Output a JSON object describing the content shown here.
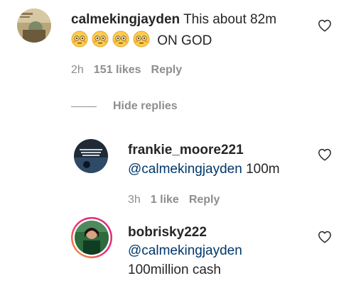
{
  "comment": {
    "username": "calmekingjayden",
    "text": "This about 82m",
    "emoji_icon": "flushed-face-emoji",
    "emoji_count": 4,
    "text2": "ON GOD",
    "time": "2h",
    "likes": "151 likes",
    "reply_label": "Reply"
  },
  "hide_replies_label": "Hide replies",
  "replies": [
    {
      "username": "frankie_moore221",
      "mention": "@calmekingjayden",
      "text": "100m",
      "time": "3h",
      "likes": "1 like",
      "reply_label": "Reply"
    },
    {
      "username": "bobrisky222",
      "mention": "@calmekingjayden",
      "text": "100million cash"
    }
  ],
  "colors": {
    "text": "#262626",
    "secondary": "#8e8e8e",
    "mention": "#00376b",
    "story_ring_start": "#f9a825",
    "story_ring_end": "#d62976"
  },
  "icons": {
    "like": "heart-outline-icon"
  }
}
